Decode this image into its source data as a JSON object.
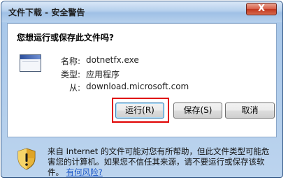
{
  "window": {
    "title": "文件下载 - 安全警告",
    "close_glyph": "X"
  },
  "dialog": {
    "question": "您想运行或保存此文件吗?",
    "file_icon": "application-window-icon",
    "fields": [
      {
        "label": "名称:",
        "value": "dotnetfx.exe"
      },
      {
        "label": "类型:",
        "value": "应用程序"
      },
      {
        "label": "从:",
        "value": "download.microsoft.com"
      }
    ]
  },
  "buttons": {
    "run": "运行(R)",
    "save": "保存(S)",
    "cancel": "取消"
  },
  "warning": {
    "icon": "security-shield-icon",
    "text": "来自 Internet 的文件可能对您有所帮助，但此文件类型可能危害您的计算机。如果您不信任其来源，请不要运行或保存该软件。",
    "link": "有何风险?"
  },
  "colors": {
    "highlight": "#e00000",
    "link": "#1a56c8",
    "title_bar": "#b5cfec"
  }
}
